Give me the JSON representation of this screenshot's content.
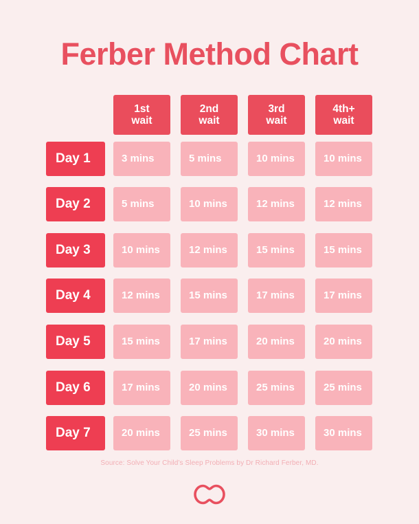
{
  "title": "Ferber Method Chart",
  "theme": {
    "background": "#FAEEEE",
    "title_color": "#E8505F",
    "header_cell_color": "#EA4D5C",
    "day_cell_color": "#EE3E52",
    "value_cell_color": "#F9B3BA",
    "cell_text_color": "#FFFFFF",
    "source_text_color": "#F2AEB4"
  },
  "table": {
    "corner_label": "",
    "column_headers": [
      "1st\nwait",
      "2nd\nwait",
      "3rd\nwait",
      "4th+\nwait"
    ],
    "column_headers_flat": [
      "1st wait",
      "2nd wait",
      "3rd wait",
      "4th+ wait"
    ],
    "row_labels": [
      "Day 1",
      "Day 2",
      "Day 3",
      "Day 4",
      "Day 5",
      "Day 6",
      "Day 7"
    ],
    "rows": [
      {
        "label": "Day 1",
        "values": [
          "3 mins",
          "5 mins",
          "10 mins",
          "10 mins"
        ]
      },
      {
        "label": "Day 2",
        "values": [
          "5 mins",
          "10 mins",
          "12 mins",
          "12 mins"
        ]
      },
      {
        "label": "Day 3",
        "values": [
          "10 mins",
          "12 mins",
          "15 mins",
          "15 mins"
        ]
      },
      {
        "label": "Day 4",
        "values": [
          "12 mins",
          "15 mins",
          "17 mins",
          "17 mins"
        ]
      },
      {
        "label": "Day 5",
        "values": [
          "15 mins",
          "17 mins",
          "20 mins",
          "20 mins"
        ]
      },
      {
        "label": "Day 6",
        "values": [
          "17 mins",
          "20 mins",
          "25 mins",
          "25 mins"
        ]
      },
      {
        "label": "Day 7",
        "values": [
          "20 mins",
          "25 mins",
          "30 mins",
          "30 mins"
        ]
      }
    ]
  },
  "source": "Source: Solve Your Child’s Sleep Problems by Dr Richard Ferber, MD.",
  "logo": {
    "name": "peanut-logo",
    "color": "#E8505F"
  },
  "chart_data": {
    "type": "table",
    "title": "Ferber Method Chart",
    "columns": [
      "",
      "1st wait",
      "2nd wait",
      "3rd wait",
      "4th+ wait"
    ],
    "row_labels": [
      "Day 1",
      "Day 2",
      "Day 3",
      "Day 4",
      "Day 5",
      "Day 6",
      "Day 7"
    ],
    "unit": "mins",
    "values": [
      [
        3,
        5,
        10,
        10
      ],
      [
        5,
        10,
        12,
        12
      ],
      [
        10,
        12,
        15,
        15
      ],
      [
        12,
        15,
        17,
        17
      ],
      [
        15,
        17,
        20,
        20
      ],
      [
        17,
        20,
        25,
        25
      ],
      [
        20,
        25,
        30,
        30
      ]
    ],
    "cell_text": [
      [
        "3 mins",
        "5 mins",
        "10 mins",
        "10 mins"
      ],
      [
        "5 mins",
        "10 mins",
        "12 mins",
        "12 mins"
      ],
      [
        "10 mins",
        "12 mins",
        "15 mins",
        "15 mins"
      ],
      [
        "12 mins",
        "15 mins",
        "17 mins",
        "17 mins"
      ],
      [
        "15 mins",
        "17 mins",
        "20 mins",
        "20 mins"
      ],
      [
        "17 mins",
        "20 mins",
        "25 mins",
        "25 mins"
      ],
      [
        "20 mins",
        "25 mins",
        "30 mins",
        "30 mins"
      ]
    ],
    "annotations": [
      "Source: Solve Your Child’s Sleep Problems by Dr Richard Ferber, MD."
    ],
    "grid": false,
    "legend": "none"
  }
}
